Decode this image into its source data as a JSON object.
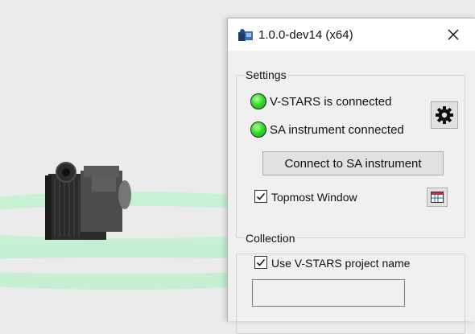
{
  "window": {
    "title": "1.0.0-dev14 (x64)",
    "app_icon": "camera-app-icon",
    "close_icon": "close-icon"
  },
  "settings": {
    "group_label": "Settings",
    "vstars_status": "V-STARS is connected",
    "sa_status": "SA instrument connected",
    "status_color": "#22cc22",
    "gear_icon": "gear-icon",
    "connect_button": "Connect to SA instrument",
    "topmost": {
      "label": "Topmost Window",
      "checked": true
    },
    "window_icon": "window-icon"
  },
  "collection": {
    "group_label": "Collection",
    "use_project_name": {
      "label": "Use V-STARS project name",
      "checked": true
    },
    "project_name_value": ""
  },
  "scene": {
    "camera_icon": "camera-model",
    "ring_color": "#c6f0d2"
  }
}
